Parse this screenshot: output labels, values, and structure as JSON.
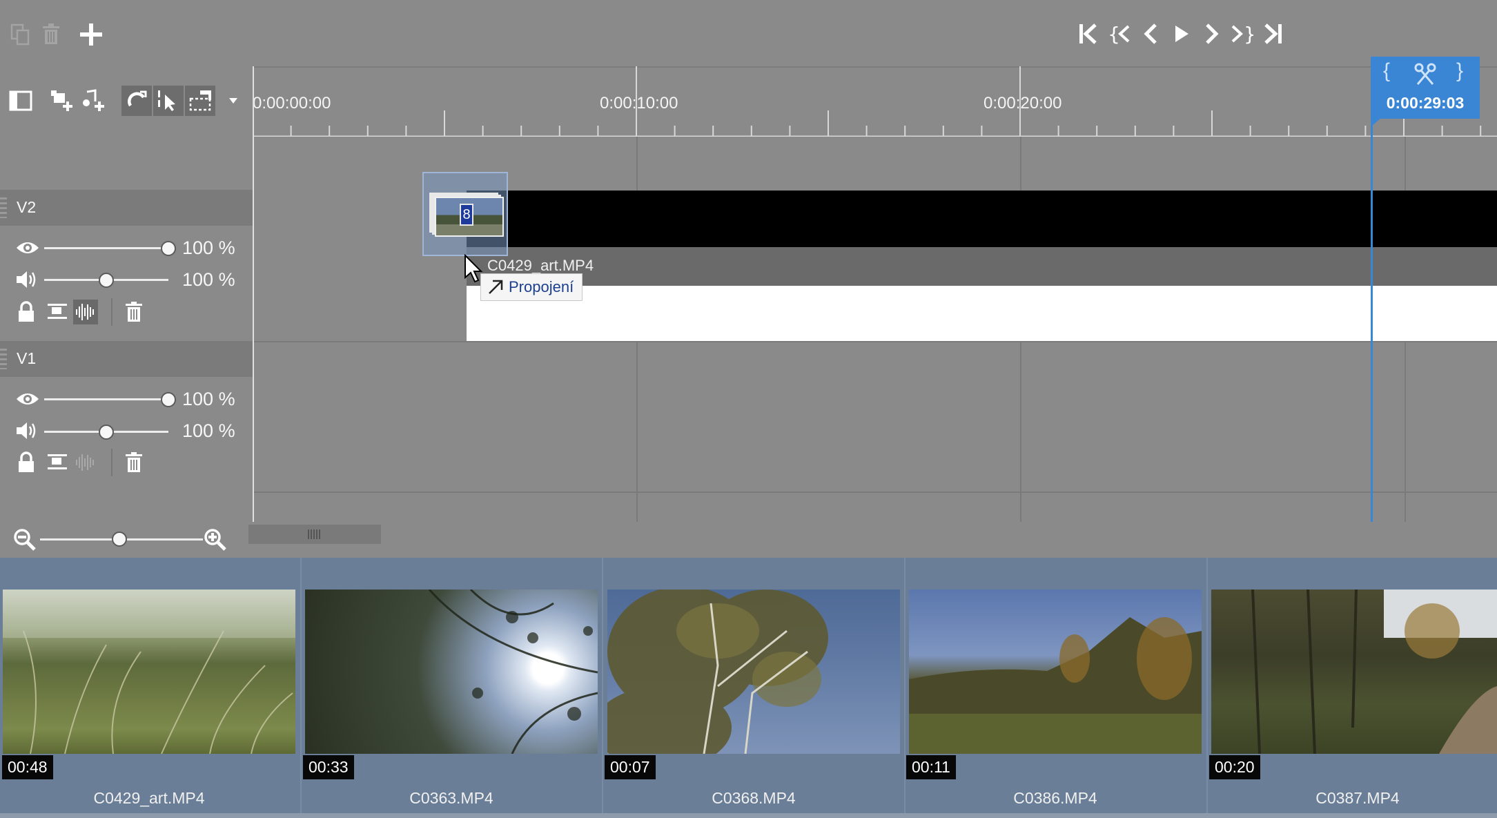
{
  "toolbar": {
    "copy_icon": "copy-icon",
    "delete_icon": "trash-icon",
    "add_icon": "plus-icon"
  },
  "transport": [
    "go-to-start-icon",
    "previous-marker-icon",
    "step-back-icon",
    "play-icon",
    "step-forward-icon",
    "next-marker-icon",
    "go-to-end-icon"
  ],
  "ruler": {
    "labels": [
      "0:00:00:00",
      "0:00:10:00",
      "0:00:20:00"
    ]
  },
  "playhead": {
    "timecode": "0:00:29:03",
    "mark_in": "{",
    "mark_out": "}"
  },
  "tracks": [
    {
      "name": "V2",
      "opacity": "100",
      "volume": "100",
      "unit": "%",
      "opacity_level": 1.0,
      "volume_level": 0.5
    },
    {
      "name": "V1",
      "opacity": "100",
      "volume": "100",
      "unit": "%",
      "opacity_level": 1.0,
      "volume_level": 0.5
    }
  ],
  "drag": {
    "count_badge": "8",
    "clip_name": "C0429_art.MP4",
    "tooltip": "Propojení"
  },
  "bin": [
    {
      "duration": "00:48",
      "name": "C0429_art.MP4"
    },
    {
      "duration": "00:33",
      "name": "C0363.MP4"
    },
    {
      "duration": "00:07",
      "name": "C0368.MP4"
    },
    {
      "duration": "00:11",
      "name": "C0386.MP4"
    },
    {
      "duration": "00:20",
      "name": "C0387.MP4"
    }
  ],
  "colors": {
    "accent": "#3a86d4",
    "bin_bg": "#6a7e97",
    "panel_bg": "#8a8a8a"
  }
}
